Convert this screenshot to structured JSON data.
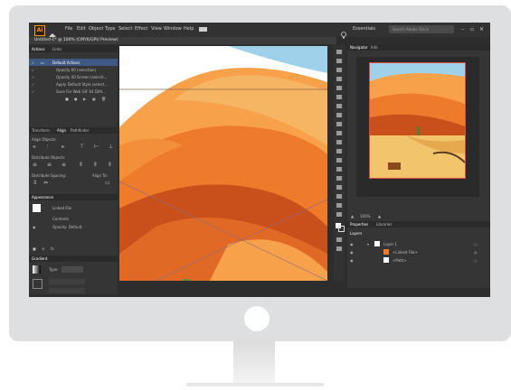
{
  "menu": {
    "logo": "Ai",
    "items": [
      "File",
      "Edit",
      "Object",
      "Type",
      "Select",
      "Effect",
      "View",
      "Window",
      "Help"
    ],
    "workspace": "Essentials",
    "search_placeholder": "Search Adobe Stock"
  },
  "document_tab": "Untitled-1* @ 100% (CMYK/GPU Preview)",
  "actions_panel": {
    "tabs": [
      "Actions",
      "Links"
    ],
    "set_name": "Default Actions",
    "items": [
      "Opacity 60 (selection)",
      "Opacity 40 Screen (selecti...",
      "Apply Default Style (select...",
      "Save For Web GIF 64 Dith..."
    ]
  },
  "align_panel": {
    "tabs": [
      "Transform",
      "Align",
      "Pathfinder"
    ],
    "align_objects": "Align Objects:",
    "distribute_objects": "Distribute Objects:",
    "distribute_spacing": "Distribute Spacing:",
    "align_to": "Align To:"
  },
  "appearance_panel": {
    "title": "Appearance",
    "selection": "Linked File",
    "contents": "Contents",
    "opacity": "Opacity: Default"
  },
  "gradient_panel": {
    "title": "Gradient",
    "type_label": "Type:"
  },
  "navigator": {
    "tabs": [
      "Navigator",
      "Info"
    ],
    "zoom": "100%"
  },
  "layers_panel": {
    "tabs": [
      "Properties",
      "Libraries"
    ],
    "header": "Layers",
    "items": [
      "Layer 1",
      "<Linked File>",
      "<Path>"
    ]
  },
  "colors": {
    "accent": "#3e5a84",
    "desert_light": "#f7a24a",
    "desert_mid": "#ee7a2c",
    "desert_dark": "#c9501a",
    "sky": "#9fd2ea"
  }
}
